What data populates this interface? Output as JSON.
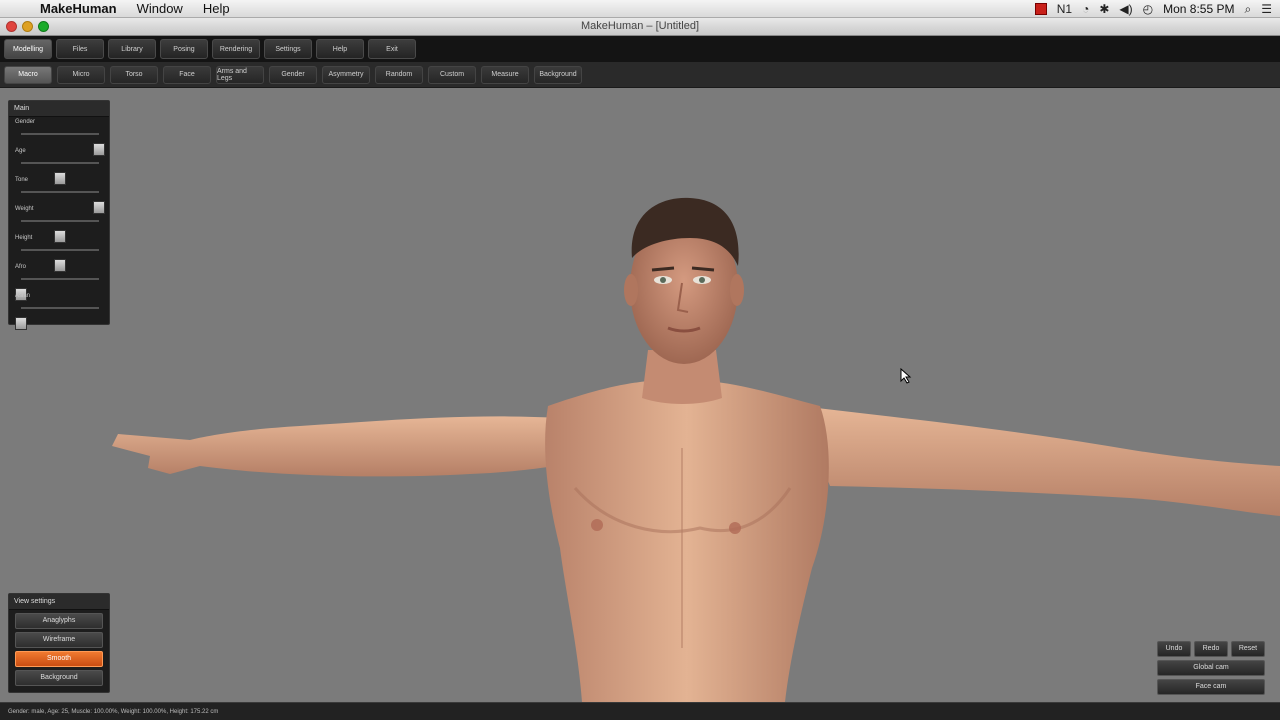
{
  "menubar": {
    "app_name": "MakeHuman",
    "items": [
      "Window",
      "Help"
    ],
    "clock": "Mon 8:55 PM",
    "tray_number": "1"
  },
  "window": {
    "title": "MakeHuman – [Untitled]"
  },
  "main_tabs": [
    {
      "label": "Modelling",
      "active": true
    },
    {
      "label": "Files"
    },
    {
      "label": "Library"
    },
    {
      "label": "Posing"
    },
    {
      "label": "Rendering"
    },
    {
      "label": "Settings"
    },
    {
      "label": "Help"
    },
    {
      "label": "Exit"
    }
  ],
  "sub_tabs": [
    {
      "label": "Macro",
      "active": true
    },
    {
      "label": "Micro"
    },
    {
      "label": "Torso"
    },
    {
      "label": "Face"
    },
    {
      "label": "Arms and Legs"
    },
    {
      "label": "Gender"
    },
    {
      "label": "Asymmetry"
    },
    {
      "label": "Random"
    },
    {
      "label": "Custom"
    },
    {
      "label": "Measure"
    },
    {
      "label": "Background"
    }
  ],
  "main_panel": {
    "title": "Main",
    "sliders": [
      {
        "label": "Gender",
        "level": 1.0
      },
      {
        "label": "Age",
        "level": 0.5
      },
      {
        "label": "Tone",
        "level": 1.0
      },
      {
        "label": "Weight",
        "level": 0.5
      },
      {
        "label": "Height",
        "level": 0.5
      },
      {
        "label": "Afro",
        "level": 0.0
      },
      {
        "label": "Asian",
        "level": 0.0
      }
    ]
  },
  "view_settings": {
    "title": "View settings",
    "buttons": [
      {
        "label": "Anaglyphs"
      },
      {
        "label": "Wireframe"
      },
      {
        "label": "Smooth",
        "active": true
      },
      {
        "label": "Background"
      }
    ]
  },
  "camera": {
    "undo": "Undo",
    "redo": "Redo",
    "reset": "Reset",
    "global_cam": "Global cam",
    "face_cam": "Face cam"
  },
  "status": "Gender: male, Age: 25, Muscle: 100.00%, Weight: 100.00%, Height: 175.22 cm",
  "colors": {
    "accent_active": "#e0622a",
    "viewport_bg": "#7b7b7b",
    "skin": "#d9a384"
  }
}
